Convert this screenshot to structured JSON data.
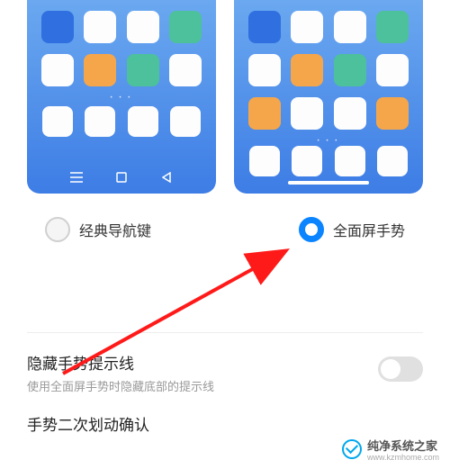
{
  "options": {
    "classic": {
      "label": "经典导航键",
      "selected": false
    },
    "gesture": {
      "label": "全面屏手势",
      "selected": true
    }
  },
  "settings": {
    "hideHint": {
      "title": "隐藏手势提示线",
      "desc": "使用全面屏手势时隐藏底部的提示线",
      "on": false
    },
    "doubleSwipe": {
      "title": "手势二次划动确认"
    }
  },
  "watermark": {
    "name": "纯净系统之家",
    "url": "www.kzmhome.com"
  }
}
